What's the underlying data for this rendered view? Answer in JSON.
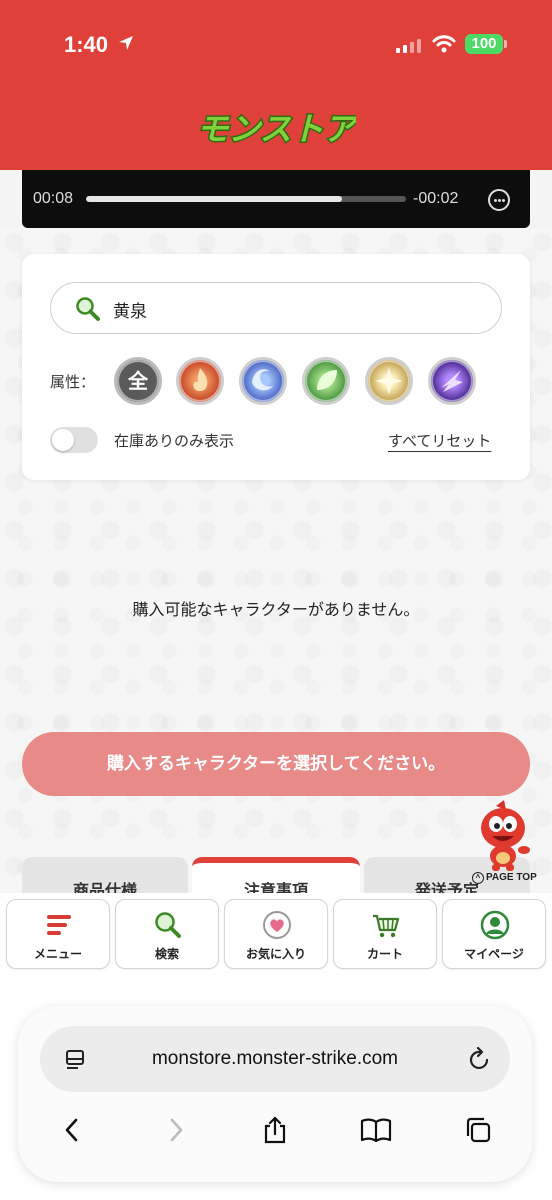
{
  "status_bar": {
    "time": "1:40",
    "battery": "100"
  },
  "brand": {
    "logo_text": "モンストア",
    "header_color": "#e0403a"
  },
  "video": {
    "elapsed": "00:08",
    "remaining": "-00:02",
    "progress": 0.8
  },
  "search": {
    "value": "黄泉",
    "attribute_label": "属性：",
    "attr_all_label": "全"
  },
  "attributes": [
    "all",
    "fire",
    "water",
    "wood",
    "light",
    "dark"
  ],
  "filter": {
    "stock_only_label": "在庫ありのみ表示",
    "stock_only_on": false,
    "reset_label": "すべてリセット"
  },
  "results": {
    "empty_message": "購入可能なキャラクターがありません。"
  },
  "cta": {
    "label": "購入するキャラクターを選択してください。"
  },
  "page_top": {
    "label": "PAGE TOP"
  },
  "tabs": [
    {
      "label": "商品仕様",
      "active": false
    },
    {
      "label": "注意事項",
      "active": true
    },
    {
      "label": "発送予定",
      "active": false
    }
  ],
  "bottom_nav": [
    {
      "label": "メニュー",
      "icon": "menu-icon"
    },
    {
      "label": "検索",
      "icon": "search-icon"
    },
    {
      "label": "お気に入り",
      "icon": "heart-icon"
    },
    {
      "label": "カート",
      "icon": "cart-icon"
    },
    {
      "label": "マイページ",
      "icon": "user-icon"
    }
  ],
  "browser": {
    "url": "monstore.monster-strike.com"
  }
}
